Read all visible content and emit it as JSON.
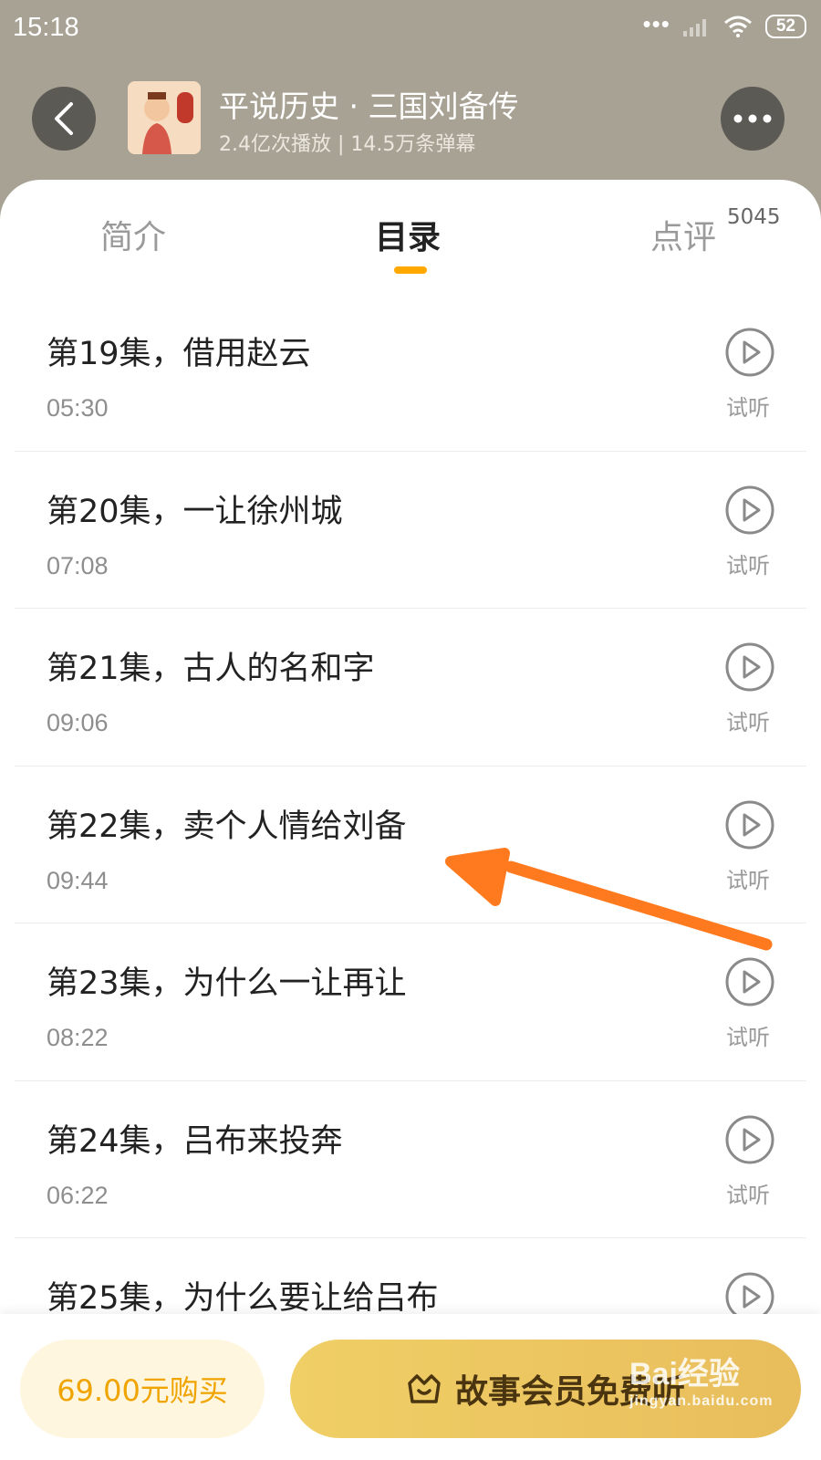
{
  "status_bar": {
    "time": "15:18",
    "battery": "52",
    "dots": "•••"
  },
  "header": {
    "title": "平说历史 · 三国刘备传",
    "stats": "2.4亿次播放 | 14.5万条弹幕"
  },
  "tabs": [
    {
      "label": "简介"
    },
    {
      "label": "目录"
    },
    {
      "label": "点评",
      "badge": "5045"
    }
  ],
  "episodes": [
    {
      "title": "第19集，借用赵云",
      "duration": "05:30",
      "action": "试听"
    },
    {
      "title": "第20集，一让徐州城",
      "duration": "07:08",
      "action": "试听"
    },
    {
      "title": "第21集，古人的名和字",
      "duration": "09:06",
      "action": "试听"
    },
    {
      "title": "第22集，卖个人情给刘备",
      "duration": "09:44",
      "action": "试听"
    },
    {
      "title": "第23集，为什么一让再让",
      "duration": "08:22",
      "action": "试听"
    },
    {
      "title": "第24集，吕布来投奔",
      "duration": "06:22",
      "action": "试听"
    },
    {
      "title": "第25集，为什么要让给吕布",
      "duration": "",
      "action": "试听"
    }
  ],
  "bottom": {
    "buy_label": "69.00元购买",
    "member_label": "故事会员免费听"
  },
  "watermark": {
    "main": "Bai经验",
    "sub": "jingyan.baidu.com"
  },
  "colors": {
    "accent": "#ffa900",
    "header_bg": "#a8a294",
    "arrow": "#ff7a1f"
  }
}
